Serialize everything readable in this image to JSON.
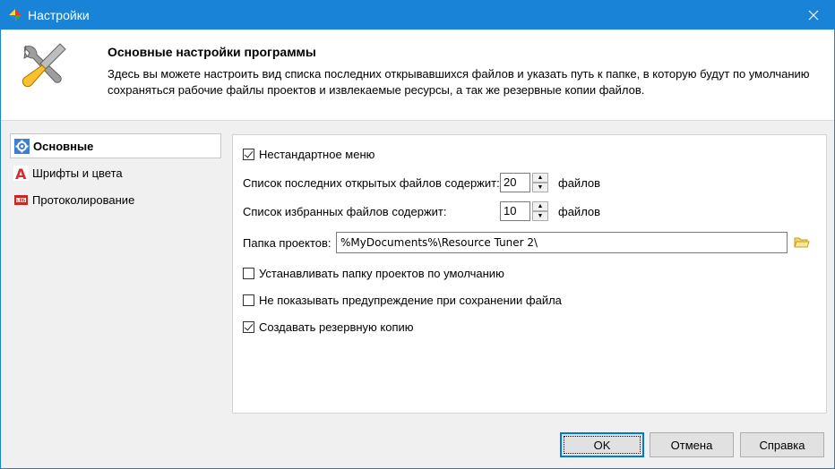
{
  "window": {
    "title": "Настройки"
  },
  "header": {
    "title": "Основные настройки программы",
    "description": "Здесь вы можете настроить вид списка последних открывавшихся файлов и указать путь к папке, в которую будут по умолчанию сохраняться рабочие файлы проектов и извлекаемые ресурсы, а так же резервные копии файлов."
  },
  "nav": {
    "items": [
      {
        "label": "Основные",
        "icon": "gear-icon",
        "selected": true
      },
      {
        "label": "Шрифты и цвета",
        "icon": "font-a-icon",
        "selected": false
      },
      {
        "label": "Протоколирование",
        "icon": "log-icon",
        "selected": false
      }
    ]
  },
  "settings": {
    "custom_menu": {
      "label": "Нестандартное меню",
      "checked": true
    },
    "recent_files": {
      "label": "Список последних открытых файлов содержит:",
      "value": "20",
      "unit": "файлов"
    },
    "favorite_files": {
      "label": "Список избранных файлов содержит:",
      "value": "10",
      "unit": "файлов"
    },
    "project_folder": {
      "label": "Папка проектов:",
      "value": "%MyDocuments%\\Resource Tuner 2\\"
    },
    "set_default_folder": {
      "label": "Устанавливать папку проектов по умолчанию",
      "checked": false
    },
    "no_save_warning": {
      "label": "Не показывать предупреждение при сохранении файла",
      "checked": false
    },
    "create_backup": {
      "label": "Создавать резервную копию",
      "checked": true
    }
  },
  "buttons": {
    "ok": "OK",
    "cancel": "Отмена",
    "help": "Справка"
  },
  "colors": {
    "titlebar": "#1883d7",
    "accent": "#0078d7"
  }
}
